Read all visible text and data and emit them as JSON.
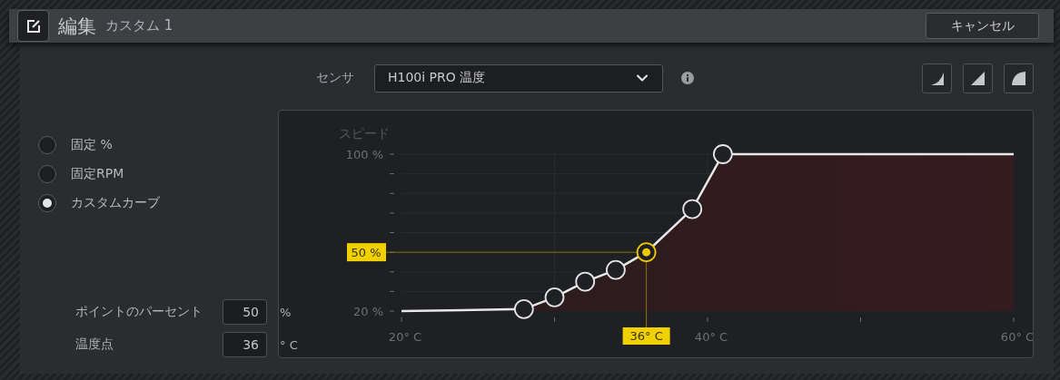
{
  "header": {
    "title": "編集",
    "subtitle": "カスタム 1",
    "cancel": "キャンセル"
  },
  "sensor": {
    "label": "センサ",
    "value": "H100i PRO 温度"
  },
  "modes": [
    {
      "label": "固定 %",
      "selected": false
    },
    {
      "label": "固定RPM",
      "selected": false
    },
    {
      "label": "カスタムカーブ",
      "selected": true
    }
  ],
  "point_fields": [
    {
      "label": "ポイントのパーセント",
      "value": "50",
      "unit": "%"
    },
    {
      "label": "温度点",
      "value": "36",
      "unit": "° C"
    }
  ],
  "chart": {
    "chart_data": {
      "type": "area",
      "ylabel": "スピード",
      "x": [
        20,
        28,
        30,
        32,
        34,
        36,
        39,
        41,
        60
      ],
      "series": [
        {
          "color": "#e8e8e8",
          "values": [
            20,
            21,
            27,
            35,
            41,
            50,
            72,
            100,
            100
          ]
        }
      ],
      "xlim": [
        20,
        60
      ],
      "ylim": [
        20,
        100
      ],
      "xticks": [
        {
          "value": 20,
          "label": "20° C"
        },
        {
          "value": 40,
          "label": "40° C"
        },
        {
          "value": 60,
          "label": "60° C"
        }
      ],
      "yticks": [
        {
          "value": 20,
          "label": "20 %"
        },
        {
          "value": 100,
          "label": "100 %"
        }
      ],
      "annotations": [
        {
          "x": 36,
          "y": 50,
          "text": "50 %"
        },
        {
          "x": 36,
          "y": 50,
          "text": "36° C"
        }
      ]
    }
  }
}
